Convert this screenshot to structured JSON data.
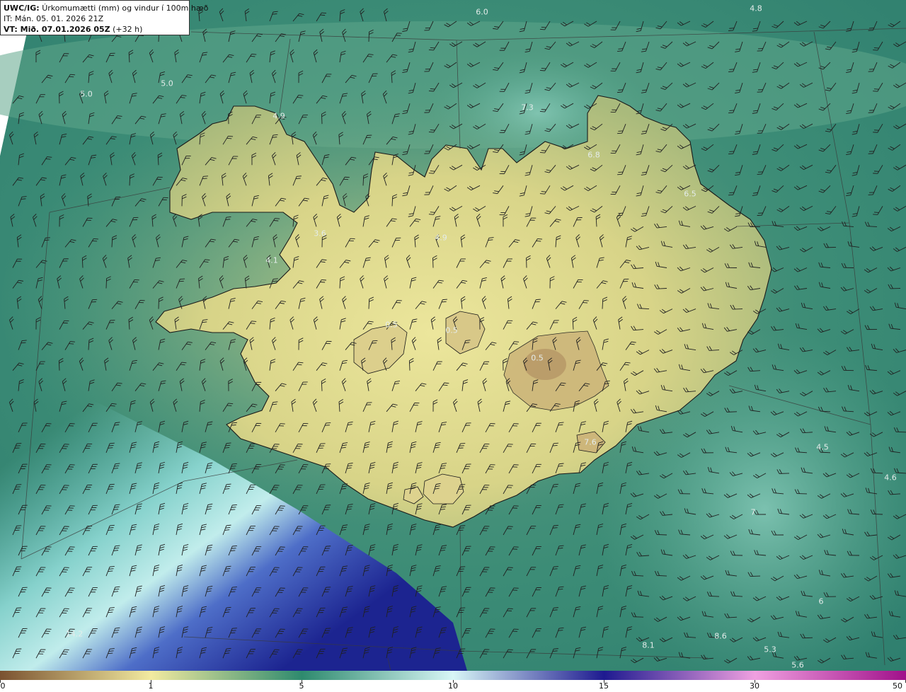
{
  "header": {
    "model": "UWC/IG:",
    "title": "Úrkomumætti (mm) og vindur í 100m hæð",
    "init_time": "IT: Mán. 05. 01. 2026 21Z",
    "valid_prefix": "VT: Mið. 07.01.2026 05Z",
    "valid_suffix": "(+32 h)"
  },
  "map_labels": [
    "6.0",
    "4.8",
    "5.0",
    "5.0",
    "4.9",
    "7.3",
    "6.8",
    "6.5",
    "3.6",
    "4.9",
    "4.1",
    "0.5",
    "0.5",
    "0.5",
    "4.5",
    "4.6",
    "14.2",
    "8.1",
    "8.6",
    "5.3",
    "5.6",
    "6",
    "7",
    "7.6"
  ],
  "colorbar": {
    "labels": [
      "0",
      "1",
      "5",
      "10",
      "15",
      "30",
      "50"
    ],
    "stops": [
      {
        "value": 0,
        "color": "#7a5230"
      },
      {
        "value": 1,
        "color": "#f2eaa0"
      },
      {
        "value": 5,
        "color": "#2e8a6e"
      },
      {
        "value": 10,
        "color": "#d8f6f6"
      },
      {
        "value": 15,
        "color": "#1e1a90"
      },
      {
        "value": 30,
        "color": "#f0a0e0"
      },
      {
        "value": 50,
        "color": "#a0108a"
      }
    ]
  },
  "colors": {
    "sea_dark": "#2a7a6a",
    "sea_mid": "#4a9a86",
    "land_low": "#c8c27a",
    "land_high": "#eae59a",
    "heavy_precip": "#1c2a96",
    "coast_line": "#1a1a1a",
    "grid_line": "#3a3a3a",
    "wind_barb": "#202020"
  }
}
